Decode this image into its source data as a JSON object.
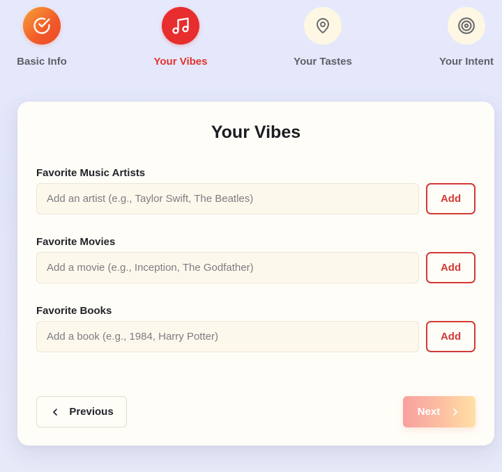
{
  "stepper": {
    "steps": [
      {
        "label": "Basic Info",
        "icon": "check-circle-icon",
        "state": "completed"
      },
      {
        "label": "Your Vibes",
        "icon": "music-note-icon",
        "state": "active"
      },
      {
        "label": "Your Tastes",
        "icon": "map-pin-icon",
        "state": "upcoming"
      },
      {
        "label": "Your Intent",
        "icon": "target-icon",
        "state": "upcoming"
      }
    ]
  },
  "form": {
    "title": "Your Vibes",
    "fields": [
      {
        "label": "Favorite Music Artists",
        "placeholder": "Add an artist (e.g., Taylor Swift, The Beatles)",
        "value": "",
        "button": "Add"
      },
      {
        "label": "Favorite Movies",
        "placeholder": "Add a movie (e.g., Inception, The Godfather)",
        "value": "",
        "button": "Add"
      },
      {
        "label": "Favorite Books",
        "placeholder": "Add a book (e.g., 1984, Harry Potter)",
        "value": "",
        "button": "Add"
      }
    ]
  },
  "nav": {
    "previous_label": "Previous",
    "next_label": "Next",
    "next_enabled": false
  },
  "colors": {
    "accent": "#e72d2d",
    "completed_gradient_start": "#f6a23a",
    "completed_gradient_end": "#ee4a25",
    "upcoming_circle": "#fdf7e4",
    "button_border": "#d23a36"
  }
}
